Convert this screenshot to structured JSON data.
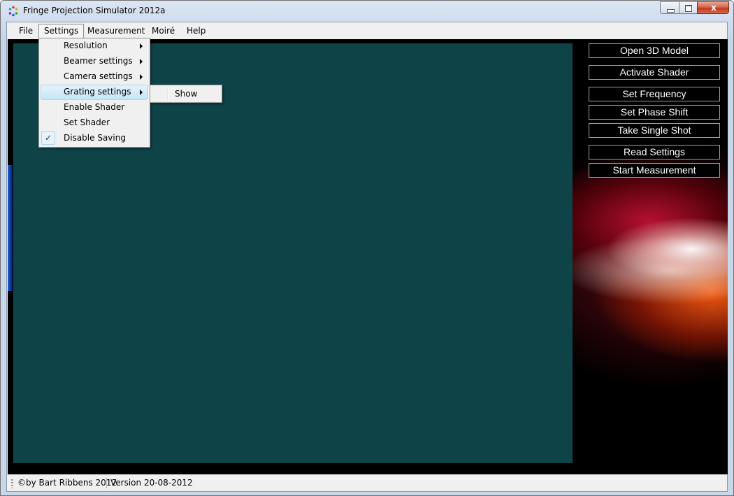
{
  "window": {
    "title": "Fringe Projection Simulator 2012a",
    "caption_close": "x"
  },
  "menubar": {
    "items": [
      "File",
      "Settings",
      "Measurement",
      "Moiré",
      "Help"
    ],
    "open_item": "Settings"
  },
  "settings_menu": {
    "items": [
      {
        "label": "Resolution",
        "submenu": true,
        "checked": false
      },
      {
        "label": "Beamer settings",
        "submenu": true,
        "checked": false
      },
      {
        "label": "Camera settings",
        "submenu": true,
        "checked": false
      },
      {
        "label": "Grating settings",
        "submenu": true,
        "checked": false,
        "highlighted": true
      },
      {
        "label": "Enable Shader",
        "submenu": false,
        "checked": false
      },
      {
        "label": "Set Shader",
        "submenu": false,
        "checked": false
      },
      {
        "label": "Disable Saving",
        "submenu": false,
        "checked": true
      }
    ],
    "check_glyph": "✓"
  },
  "grating_submenu": {
    "items": [
      "Show"
    ]
  },
  "right_panel": {
    "buttons": [
      "Open 3D Model",
      "Activate Shader",
      "Set Frequency",
      "Set Phase Shift",
      "Take Single Shot",
      "Read Settings",
      "Start Measurement"
    ]
  },
  "statusbar": {
    "copyright": "©by Bart Ribbens 2012",
    "version": "Version 20-08-2012"
  },
  "colors": {
    "viewport": "#0e4448",
    "panel_button_border": "#a0a0a0",
    "menu_highlight": "#c4e5f6"
  }
}
